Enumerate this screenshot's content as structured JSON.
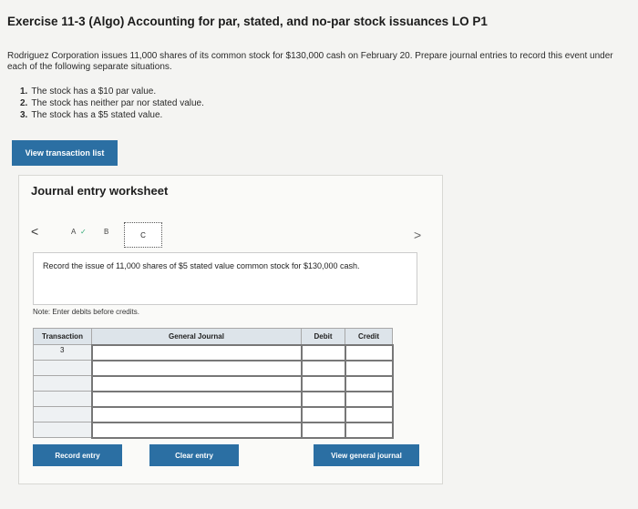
{
  "header": {
    "title": "Exercise 11-3 (Algo) Accounting for par, stated, and no-par stock issuances LO P1"
  },
  "intro": "Rodriguez Corporation issues 11,000 shares of its common stock for $130,000 cash on February 20. Prepare journal entries to record this event under each of the following separate situations.",
  "situations": [
    {
      "num": "1.",
      "text": "The stock has a $10 par value."
    },
    {
      "num": "2.",
      "text": "The stock has neither par nor stated value."
    },
    {
      "num": "3.",
      "text": "The stock has a $5 stated value."
    }
  ],
  "view_transaction_button": "View transaction list",
  "worksheet": {
    "title": "Journal entry worksheet",
    "nav": {
      "prev": "<",
      "next": ">",
      "tabs": [
        "A",
        "B",
        "C"
      ],
      "check": "✓",
      "active_tab": "C"
    },
    "instruction": "Record the issue of 11,000 shares of $5 stated value common stock for $130,000 cash.",
    "note": "Note: Enter debits before credits.",
    "table": {
      "headers": {
        "transaction": "Transaction",
        "general_journal": "General Journal",
        "debit": "Debit",
        "credit": "Credit"
      },
      "rows": [
        {
          "transaction": "3",
          "account": "",
          "debit": "",
          "credit": ""
        },
        {
          "transaction": "",
          "account": "",
          "debit": "",
          "credit": ""
        },
        {
          "transaction": "",
          "account": "",
          "debit": "",
          "credit": ""
        },
        {
          "transaction": "",
          "account": "",
          "debit": "",
          "credit": ""
        },
        {
          "transaction": "",
          "account": "",
          "debit": "",
          "credit": ""
        },
        {
          "transaction": "",
          "account": "",
          "debit": "",
          "credit": ""
        }
      ]
    },
    "buttons": {
      "record": "Record entry",
      "clear": "Clear entry",
      "view_journal": "View general journal"
    }
  },
  "colors": {
    "button": "#2b6fa3",
    "header_bg": "#dde4ea",
    "page_bg": "#f4f4f2"
  }
}
